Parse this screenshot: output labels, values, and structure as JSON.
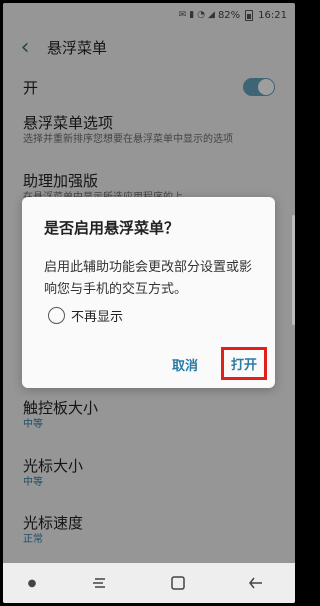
{
  "status_bar": {
    "battery": "82%",
    "time": "16:21"
  },
  "header": {
    "title": "悬浮菜单"
  },
  "master_switch": {
    "label": "开",
    "on": true
  },
  "settings": [
    {
      "title": "悬浮菜单选项",
      "subtitle": "选择并重新排序您想要在悬浮菜单中显示的选项"
    },
    {
      "title": "助理加强版",
      "subtitle": "在悬浮菜单中显示所选应用程序的上"
    },
    {
      "title": "触控板大小",
      "subtitle": "中等"
    },
    {
      "title": "光标大小",
      "subtitle": "中等"
    },
    {
      "title": "光标速度",
      "subtitle": "正常"
    }
  ],
  "dialog": {
    "title": "是否启用悬浮菜单？",
    "message": "启用此辅助功能会更改部分设置或影响您与手机的交互方式。",
    "checkbox_label": "不再显示",
    "cancel_label": "取消",
    "open_label": "打开"
  },
  "colors": {
    "accent": "#2a7aa6",
    "highlight_border": "#e0201a",
    "toggle_on": "#63a3bf"
  }
}
